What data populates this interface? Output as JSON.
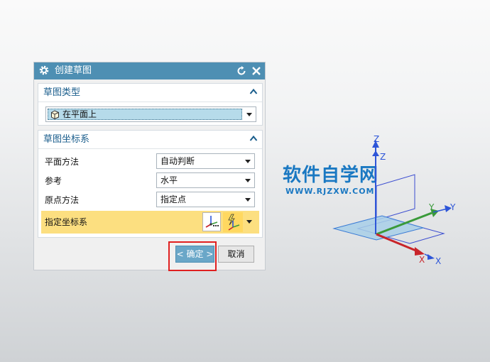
{
  "dialog": {
    "title": "创建草图",
    "title_icon": "gear-icon",
    "reset_icon": "reset-icon",
    "close_icon": "close-icon"
  },
  "sketch_type": {
    "title": "草图类型",
    "value": "在平面上"
  },
  "sketch_csys": {
    "title": "草图坐标系",
    "rows": [
      {
        "label": "平面方法",
        "value": "自动判断"
      },
      {
        "label": "参考",
        "value": "水平"
      },
      {
        "label": "原点方法",
        "value": "指定点"
      }
    ],
    "specify_label": "指定坐标系"
  },
  "buttons": {
    "ok": "< 确定 >",
    "cancel": "取消"
  },
  "watermark": {
    "main": "软件自学网",
    "sub": "WWW.RJZXW.COM"
  },
  "axes": {
    "z": "Z",
    "y": "Y",
    "x": "X"
  },
  "colors": {
    "title_bar": "#4e8fb3",
    "group_title": "#1a5d8c",
    "highlight_row": "#fcdf80",
    "highlight_box": "#e02020",
    "axis_z": "#2d55d8",
    "axis_y": "#3a9a3a",
    "axis_x": "#c8242a"
  }
}
